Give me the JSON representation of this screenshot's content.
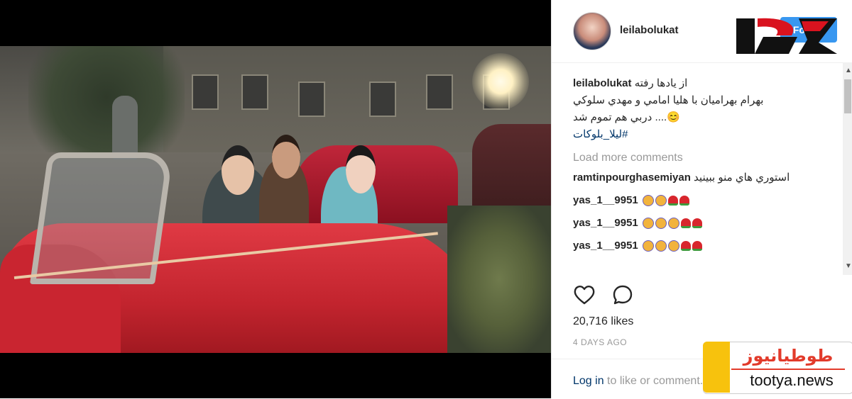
{
  "post": {
    "username": "leilabolukat",
    "follow_label": "Follow",
    "caption": {
      "user": "leilabolukat",
      "line1": "از يادها رفته",
      "line2": "بهرام بهراميان با هليا امامي و مهدي سلوكي",
      "line3": "😊.... دربي هم تموم شد",
      "hashtag": "#ليلا_بلوكات"
    },
    "load_more": "Load more comments",
    "comments": [
      {
        "user": "ramtinpourghasemiyan",
        "text": "استوري هاي منو ببينيد"
      },
      {
        "user": "yas_1__9951",
        "emojis": [
          "face",
          "face",
          "rose",
          "rose"
        ]
      },
      {
        "user": "yas_1__9951",
        "emojis": [
          "face",
          "face",
          "face",
          "rose",
          "rose"
        ]
      },
      {
        "user": "yas_1__9951",
        "emojis": [
          "face",
          "face",
          "face",
          "rose",
          "rose"
        ]
      }
    ],
    "likes": "20,716 likes",
    "time": "4 DAYS AGO",
    "login_link": "Log in",
    "login_rest": "to like or comment."
  },
  "watermarks": {
    "tootya_fa": "طوطیانیوز",
    "tootya_en": "tootya.news"
  },
  "icons": {
    "like": "heart-icon",
    "comment": "comment-icon"
  },
  "colors": {
    "follow": "#3897f0",
    "link": "#003569",
    "watermark_red": "#e23b2b",
    "watermark_yellow": "#f7c20d"
  }
}
